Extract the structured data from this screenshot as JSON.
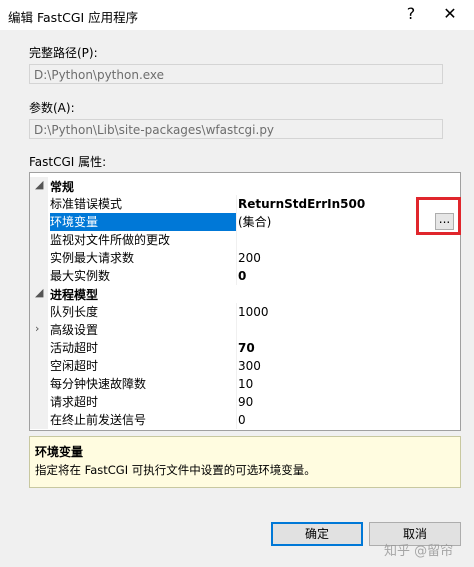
{
  "window": {
    "title": "编辑 FastCGI 应用程序",
    "help_label": "?",
    "close_label": "✕"
  },
  "full_path": {
    "label": "完整路径(P):",
    "value": "D:\\Python\\python.exe"
  },
  "arguments": {
    "label": "参数(A):",
    "value": "D:\\Python\\Lib\\site-packages\\wfastcgi.py"
  },
  "properties": {
    "label": "FastCGI 属性:",
    "rows": [
      {
        "type": "category",
        "caret": "◢",
        "name": "常规"
      },
      {
        "type": "prop",
        "name": "标准错误模式",
        "value": "ReturnStdErrIn500",
        "bold": true
      },
      {
        "type": "prop",
        "name": "环境变量",
        "value": "(集合)",
        "bold": false,
        "selected": true
      },
      {
        "type": "prop",
        "name": "监视对文件所做的更改",
        "value": "",
        "bold": false
      },
      {
        "type": "prop",
        "name": "实例最大请求数",
        "value": "200",
        "bold": false
      },
      {
        "type": "prop",
        "name": "最大实例数",
        "value": "0",
        "bold": true
      },
      {
        "type": "category",
        "caret": "◢",
        "name": "进程模型"
      },
      {
        "type": "prop",
        "name": "队列长度",
        "value": "1000",
        "bold": false
      },
      {
        "type": "prop",
        "name": "高级设置",
        "value": "",
        "bold": false,
        "expander": "›"
      },
      {
        "type": "prop",
        "name": "活动超时",
        "value": "70",
        "bold": true
      },
      {
        "type": "prop",
        "name": "空闲超时",
        "value": "300",
        "bold": false
      },
      {
        "type": "prop",
        "name": "每分钟快速故障数",
        "value": "10",
        "bold": false
      },
      {
        "type": "prop",
        "name": "请求超时",
        "value": "90",
        "bold": false
      },
      {
        "type": "prop",
        "name": "在终止前发送信号",
        "value": "0",
        "bold": false
      }
    ],
    "ellipsis_label": "..."
  },
  "description": {
    "title": "环境变量",
    "text": "指定将在 FastCGI 可执行文件中设置的可选环境变量。"
  },
  "buttons": {
    "ok": "确定",
    "cancel": "取消"
  },
  "watermark": "知乎 @留帘",
  "colors": {
    "selection": "#0078d7",
    "highlight_box": "#e0262c",
    "description_bg": "#fffce0"
  }
}
